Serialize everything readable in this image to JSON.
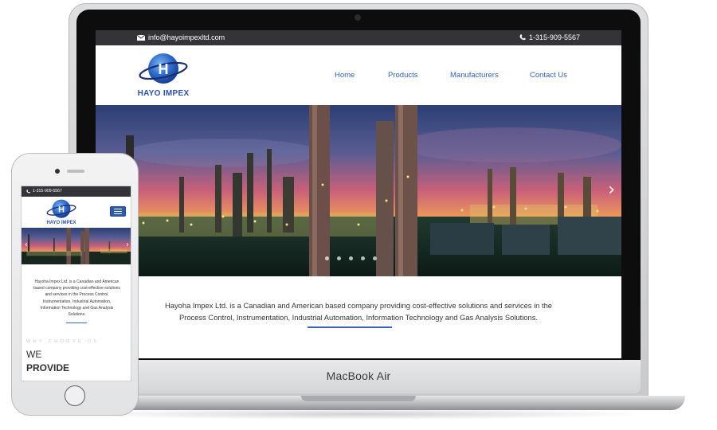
{
  "desktop": {
    "topbar": {
      "email": "info@hayoimpexltd.com",
      "phone": "1-315-909-5567",
      "email_icon": "envelope-icon",
      "phone_icon": "phone-icon"
    },
    "logo": {
      "text": "HAYO IMPEX",
      "letter": "H"
    },
    "nav": {
      "items": [
        {
          "label": "Home"
        },
        {
          "label": "Products"
        },
        {
          "label": "Manufacturers"
        },
        {
          "label": "Contact Us"
        }
      ]
    },
    "hero": {
      "next_icon": "chevron-right-icon",
      "slide_count": 5
    },
    "intro": {
      "text": "Hayoha Impex Ltd. is a Canadian and American based company providing cost-effective solutions and services in the Process Control, Instrumentation, Industrial Automation, Information Technology and Gas Analysis Solutions."
    }
  },
  "laptop": {
    "brand": "MacBook Air"
  },
  "mobile": {
    "topbar": {
      "phone": "1-315-909-5567",
      "phone_icon": "phone-icon"
    },
    "logo": {
      "text": "HAYO IMPEX",
      "letter": "H"
    },
    "menu_icon": "hamburger-menu-icon",
    "hero": {
      "prev_icon": "chevron-left-icon",
      "next_icon": "chevron-right-icon"
    },
    "intro": {
      "text": "Hayoha Impex Ltd. is a Canadian and American based company providing cost-effective solutions and services in the Process Control, Instrumentation, Industrial Automation, Information Technology and Gas Analysis Solutions."
    },
    "section": {
      "eyebrow": "WHY CHOOSE US",
      "heading_line1": "WE",
      "heading_line2": "PROVIDE"
    }
  },
  "colors": {
    "accent_blue": "#2f5fb3",
    "topbar_dark": "#333438",
    "logo_blue": "#2e4fb0"
  }
}
